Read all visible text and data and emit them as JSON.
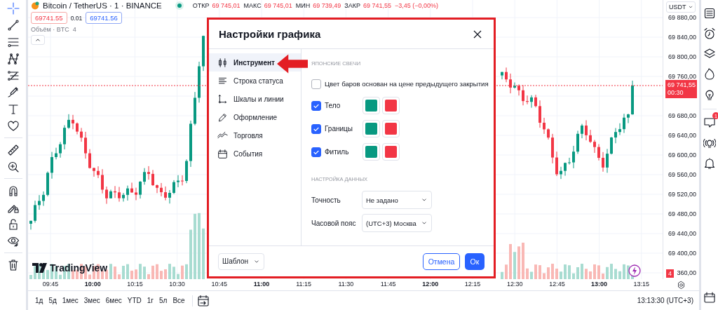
{
  "left_toolbar": [
    {
      "kind": "crosshair",
      "selected": true
    },
    {
      "kind": "trend_line",
      "selected": false
    },
    {
      "kind": "horizontal_lines",
      "selected": false
    },
    {
      "kind": "pattern",
      "selected": false
    },
    {
      "kind": "projection",
      "selected": false
    },
    {
      "kind": "brush",
      "selected": false
    },
    {
      "kind": "text",
      "selected": false
    },
    {
      "kind": "favorites",
      "selected": false
    },
    {
      "kind": "divider"
    },
    {
      "kind": "ruler",
      "selected": false
    },
    {
      "kind": "zoom_in",
      "selected": false
    },
    {
      "kind": "divider"
    },
    {
      "kind": "magnet",
      "selected": false
    },
    {
      "kind": "drawing_lock",
      "selected": false
    },
    {
      "kind": "lock",
      "selected": false
    },
    {
      "kind": "visibility",
      "selected": false
    },
    {
      "kind": "divider"
    },
    {
      "kind": "trash",
      "selected": false
    }
  ],
  "legend": {
    "symbol": "Bitcoin / TetherUS · 1 · BINANCE",
    "ohlc": [
      {
        "label": "ОТКР",
        "value": "69 745,01"
      },
      {
        "label": "МАКС",
        "value": "69 745,01"
      },
      {
        "label": "МИН",
        "value": "69 739,49"
      },
      {
        "label": "ЗАКР",
        "value": "69 741,55"
      }
    ],
    "change": "−3,45 (−0,00%)",
    "sell_price": "69741.55",
    "spread": "0.01",
    "buy_price": "69741.56",
    "volume_label": "Объём · BTC",
    "volume_value": "4"
  },
  "logo": "TradingView",
  "currency": "USDT",
  "price_scale": {
    "ticks": [
      "69 880,00",
      "69 840,00",
      "69 800,00",
      "69 760,00",
      "69 680,00",
      "69 640,00",
      "69 600,00",
      "69 560,00",
      "69 520,00",
      "69 480,00",
      "69 440,00",
      "69 400,00",
      "360,00"
    ],
    "last_price": "69 741,55",
    "countdown": "00:30",
    "volume_tag": "4"
  },
  "time_axis": [
    {
      "label": "09:45",
      "major": false
    },
    {
      "label": "10:00",
      "major": true
    },
    {
      "label": "10:15",
      "major": false
    },
    {
      "label": "10:30",
      "major": false
    },
    {
      "label": "10:45",
      "major": false
    },
    {
      "label": "11:00",
      "major": true
    },
    {
      "label": "11:15",
      "major": false
    },
    {
      "label": "11:30",
      "major": false
    },
    {
      "label": "11:45",
      "major": false
    },
    {
      "label": "12:00",
      "major": true
    },
    {
      "label": "12:15",
      "major": false
    },
    {
      "label": "12:30",
      "major": false
    },
    {
      "label": "12:45",
      "major": false
    },
    {
      "label": "13:00",
      "major": true
    },
    {
      "label": "13:15",
      "major": false
    }
  ],
  "bottom_bar": {
    "ranges": [
      "1д",
      "5д",
      "1мес",
      "3мес",
      "6мес",
      "YTD",
      "1г",
      "5л",
      "Все"
    ],
    "clock": "13:13:30 (UTC+3)"
  },
  "right_toolbar": [
    {
      "kind": "watchlist"
    },
    {
      "kind": "alerts"
    },
    {
      "kind": "object_tree"
    },
    {
      "kind": "hotlists"
    },
    {
      "kind": "ideas"
    },
    {
      "kind": "divider"
    },
    {
      "kind": "chats",
      "badge": "1"
    },
    {
      "kind": "streams"
    },
    {
      "kind": "notifications"
    }
  ],
  "right_toolbar_bottom": [
    {
      "kind": "calendar"
    }
  ],
  "dialog": {
    "title": "Настройки графика",
    "nav": [
      {
        "kind": "symbol",
        "label": "Инструмент",
        "selected": true
      },
      {
        "kind": "status_line",
        "label": "Строка статуса",
        "selected": false
      },
      {
        "kind": "scales",
        "label": "Шкалы и линии",
        "selected": false
      },
      {
        "kind": "appearance",
        "label": "Оформление",
        "selected": false
      },
      {
        "kind": "trading",
        "label": "Торговля",
        "selected": false
      },
      {
        "kind": "events",
        "label": "События",
        "selected": false
      }
    ],
    "sections": [
      {
        "heading": "ЯПОНСКИЕ СВЕЧИ",
        "rows": [
          {
            "kind": "checkbox",
            "label": "Цвет баров основан на цене предыдущего закрытия",
            "checked": false
          },
          {
            "kind": "color_pair",
            "label": "Тело",
            "checked": true,
            "swatches": [
              {
                "color": "#089981"
              },
              {
                "color": "#f23645"
              }
            ]
          },
          {
            "kind": "color_pair",
            "label": "Границы",
            "checked": true,
            "swatches": [
              {
                "color": "#089981"
              },
              {
                "color": "#f23645"
              }
            ]
          },
          {
            "kind": "color_pair",
            "label": "Фитиль",
            "checked": true,
            "swatches": [
              {
                "color": "#089981"
              },
              {
                "color": "#f23645"
              }
            ]
          }
        ]
      },
      {
        "heading": "НАСТРОЙКА ДАННЫХ",
        "rows": [
          {
            "kind": "select",
            "label": "Точность",
            "value": "Не задано"
          },
          {
            "kind": "select",
            "label": "Часовой пояс",
            "value": "(UTC+3) Москва"
          }
        ]
      }
    ],
    "template": "Шаблон",
    "cancel": "Отмена",
    "ok": "Ок"
  }
}
